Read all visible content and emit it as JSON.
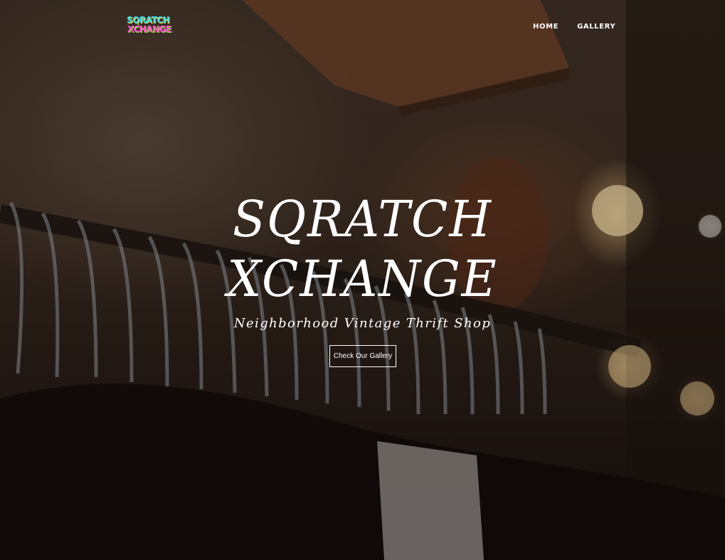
{
  "brand": {
    "logo_line1": "SQRATCH",
    "logo_line2": "XCHANGE"
  },
  "nav": {
    "items": [
      {
        "label": "HOME"
      },
      {
        "label": "GALLERY"
      }
    ]
  },
  "hero": {
    "title_line1": "SQRATCH",
    "title_line2": "XCHANGE",
    "tagline": "Neighborhood Vintage Thrift Shop",
    "cta_label": "Check Our Gallery"
  }
}
